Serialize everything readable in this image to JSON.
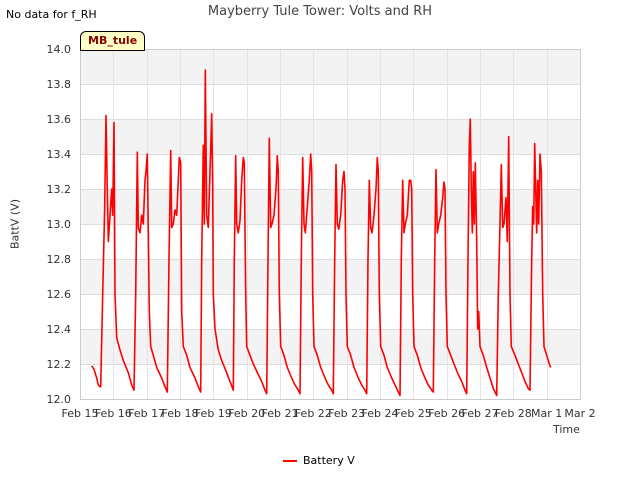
{
  "note": "No data for f_RH",
  "badge": "MB_tule",
  "chart_data": {
    "type": "line",
    "title": "Mayberry Tule Tower: Volts and RH",
    "xlabel": "Time",
    "ylabel": "BattV (V)",
    "ylim": [
      12.0,
      14.0
    ],
    "yticks": [
      12.0,
      12.2,
      12.4,
      12.6,
      12.8,
      13.0,
      13.2,
      13.4,
      13.6,
      13.8,
      14.0
    ],
    "ytick_labels": [
      "12.0",
      "12.2",
      "12.4",
      "12.6",
      "12.8",
      "13.0",
      "13.2",
      "13.4",
      "13.6",
      "13.8",
      "14.0"
    ],
    "xlim": [
      0,
      15
    ],
    "xticks": [
      0,
      1,
      2,
      3,
      4,
      5,
      6,
      7,
      8,
      9,
      10,
      11,
      12,
      13,
      14,
      15
    ],
    "xtick_labels": [
      "Feb 15",
      "Feb 16",
      "Feb 17",
      "Feb 18",
      "Feb 19",
      "Feb 20",
      "Feb 21",
      "Feb 22",
      "Feb 23",
      "Feb 24",
      "Feb 25",
      "Feb 26",
      "Feb 27",
      "Feb 28",
      "Mar 1",
      "Mar 2"
    ],
    "grid": true,
    "legend_position": "bottom",
    "series": [
      {
        "name": "Battery V",
        "color": "#ff0000",
        "points": [
          [
            0.35,
            12.19
          ],
          [
            0.42,
            12.17
          ],
          [
            0.5,
            12.12
          ],
          [
            0.55,
            12.08
          ],
          [
            0.6,
            12.07
          ],
          [
            0.62,
            12.07
          ],
          [
            0.68,
            12.6
          ],
          [
            0.74,
            13.1
          ],
          [
            0.78,
            13.62
          ],
          [
            0.82,
            13.2
          ],
          [
            0.85,
            12.9
          ],
          [
            0.9,
            13.05
          ],
          [
            0.95,
            13.2
          ],
          [
            0.98,
            13.05
          ],
          [
            1.02,
            13.58
          ],
          [
            1.05,
            12.6
          ],
          [
            1.1,
            12.35
          ],
          [
            1.2,
            12.28
          ],
          [
            1.3,
            12.22
          ],
          [
            1.45,
            12.15
          ],
          [
            1.55,
            12.08
          ],
          [
            1.62,
            12.05
          ],
          [
            1.67,
            12.6
          ],
          [
            1.72,
            13.41
          ],
          [
            1.75,
            12.98
          ],
          [
            1.8,
            12.95
          ],
          [
            1.85,
            13.05
          ],
          [
            1.9,
            13.0
          ],
          [
            1.95,
            13.25
          ],
          [
            1.98,
            13.3
          ],
          [
            2.02,
            13.4
          ],
          [
            2.08,
            12.5
          ],
          [
            2.12,
            12.3
          ],
          [
            2.2,
            12.25
          ],
          [
            2.3,
            12.18
          ],
          [
            2.45,
            12.12
          ],
          [
            2.55,
            12.07
          ],
          [
            2.62,
            12.04
          ],
          [
            2.67,
            12.8
          ],
          [
            2.72,
            13.42
          ],
          [
            2.75,
            12.98
          ],
          [
            2.8,
            13.0
          ],
          [
            2.85,
            13.08
          ],
          [
            2.9,
            13.05
          ],
          [
            2.95,
            13.25
          ],
          [
            2.98,
            13.38
          ],
          [
            3.02,
            13.35
          ],
          [
            3.05,
            12.5
          ],
          [
            3.1,
            12.3
          ],
          [
            3.2,
            12.25
          ],
          [
            3.3,
            12.18
          ],
          [
            3.45,
            12.12
          ],
          [
            3.55,
            12.07
          ],
          [
            3.62,
            12.04
          ],
          [
            3.65,
            12.8
          ],
          [
            3.7,
            13.45
          ],
          [
            3.73,
            13.0
          ],
          [
            3.76,
            13.88
          ],
          [
            3.8,
            13.05
          ],
          [
            3.85,
            12.98
          ],
          [
            3.9,
            13.3
          ],
          [
            3.95,
            13.63
          ],
          [
            3.98,
            13.2
          ],
          [
            4.0,
            12.6
          ],
          [
            4.05,
            12.4
          ],
          [
            4.15,
            12.28
          ],
          [
            4.25,
            12.22
          ],
          [
            4.4,
            12.15
          ],
          [
            4.5,
            12.1
          ],
          [
            4.6,
            12.05
          ],
          [
            4.63,
            12.8
          ],
          [
            4.67,
            13.39
          ],
          [
            4.7,
            13.0
          ],
          [
            4.75,
            12.95
          ],
          [
            4.8,
            13.02
          ],
          [
            4.85,
            13.25
          ],
          [
            4.9,
            13.38
          ],
          [
            4.93,
            13.35
          ],
          [
            4.97,
            12.6
          ],
          [
            5.0,
            12.3
          ],
          [
            5.1,
            12.25
          ],
          [
            5.2,
            12.2
          ],
          [
            5.35,
            12.14
          ],
          [
            5.45,
            12.1
          ],
          [
            5.55,
            12.05
          ],
          [
            5.6,
            12.03
          ],
          [
            5.64,
            12.8
          ],
          [
            5.68,
            13.49
          ],
          [
            5.72,
            12.98
          ],
          [
            5.76,
            13.0
          ],
          [
            5.82,
            13.05
          ],
          [
            5.88,
            13.2
          ],
          [
            5.92,
            13.39
          ],
          [
            5.95,
            13.3
          ],
          [
            5.98,
            12.6
          ],
          [
            6.02,
            12.3
          ],
          [
            6.12,
            12.25
          ],
          [
            6.22,
            12.18
          ],
          [
            6.35,
            12.12
          ],
          [
            6.45,
            12.08
          ],
          [
            6.55,
            12.05
          ],
          [
            6.6,
            12.03
          ],
          [
            6.64,
            12.8
          ],
          [
            6.68,
            13.38
          ],
          [
            6.72,
            13.0
          ],
          [
            6.76,
            12.95
          ],
          [
            6.82,
            13.1
          ],
          [
            6.88,
            13.25
          ],
          [
            6.92,
            13.4
          ],
          [
            6.95,
            13.3
          ],
          [
            6.98,
            12.6
          ],
          [
            7.02,
            12.3
          ],
          [
            7.12,
            12.25
          ],
          [
            7.22,
            12.18
          ],
          [
            7.35,
            12.12
          ],
          [
            7.45,
            12.08
          ],
          [
            7.55,
            12.05
          ],
          [
            7.6,
            12.03
          ],
          [
            7.64,
            12.8
          ],
          [
            7.68,
            13.34
          ],
          [
            7.72,
            13.0
          ],
          [
            7.76,
            12.97
          ],
          [
            7.82,
            13.05
          ],
          [
            7.88,
            13.25
          ],
          [
            7.92,
            13.3
          ],
          [
            7.95,
            13.2
          ],
          [
            7.98,
            12.6
          ],
          [
            8.02,
            12.3
          ],
          [
            8.12,
            12.25
          ],
          [
            8.22,
            12.18
          ],
          [
            8.35,
            12.12
          ],
          [
            8.45,
            12.08
          ],
          [
            8.55,
            12.05
          ],
          [
            8.6,
            12.03
          ],
          [
            8.64,
            12.8
          ],
          [
            8.68,
            13.25
          ],
          [
            8.72,
            12.98
          ],
          [
            8.76,
            12.95
          ],
          [
            8.82,
            13.05
          ],
          [
            8.88,
            13.2
          ],
          [
            8.92,
            13.38
          ],
          [
            8.95,
            13.3
          ],
          [
            8.98,
            12.6
          ],
          [
            9.02,
            12.3
          ],
          [
            9.12,
            12.25
          ],
          [
            9.22,
            12.18
          ],
          [
            9.35,
            12.12
          ],
          [
            9.45,
            12.08
          ],
          [
            9.55,
            12.04
          ],
          [
            9.6,
            12.02
          ],
          [
            9.64,
            12.8
          ],
          [
            9.68,
            13.25
          ],
          [
            9.72,
            12.95
          ],
          [
            9.76,
            13.0
          ],
          [
            9.82,
            13.05
          ],
          [
            9.88,
            13.25
          ],
          [
            9.92,
            13.25
          ],
          [
            9.95,
            13.2
          ],
          [
            9.98,
            12.6
          ],
          [
            10.02,
            12.3
          ],
          [
            10.12,
            12.25
          ],
          [
            10.22,
            12.18
          ],
          [
            10.35,
            12.12
          ],
          [
            10.45,
            12.08
          ],
          [
            10.55,
            12.05
          ],
          [
            10.6,
            12.04
          ],
          [
            10.64,
            12.8
          ],
          [
            10.68,
            13.31
          ],
          [
            10.72,
            12.95
          ],
          [
            10.76,
            13.0
          ],
          [
            10.82,
            13.05
          ],
          [
            10.88,
            13.15
          ],
          [
            10.92,
            13.24
          ],
          [
            10.95,
            13.2
          ],
          [
            10.98,
            12.6
          ],
          [
            11.02,
            12.3
          ],
          [
            11.12,
            12.25
          ],
          [
            11.22,
            12.2
          ],
          [
            11.35,
            12.14
          ],
          [
            11.45,
            12.1
          ],
          [
            11.55,
            12.05
          ],
          [
            11.6,
            12.03
          ],
          [
            11.64,
            12.8
          ],
          [
            11.68,
            13.45
          ],
          [
            11.71,
            13.6
          ],
          [
            11.74,
            13.2
          ],
          [
            11.77,
            12.95
          ],
          [
            11.8,
            13.3
          ],
          [
            11.83,
            13.0
          ],
          [
            11.86,
            13.35
          ],
          [
            11.9,
            12.9
          ],
          [
            11.93,
            12.4
          ],
          [
            11.96,
            12.5
          ],
          [
            12.0,
            12.3
          ],
          [
            12.1,
            12.25
          ],
          [
            12.2,
            12.18
          ],
          [
            12.3,
            12.12
          ],
          [
            12.4,
            12.06
          ],
          [
            12.5,
            12.02
          ],
          [
            12.55,
            12.6
          ],
          [
            12.6,
            13.0
          ],
          [
            12.64,
            13.34
          ],
          [
            12.68,
            12.98
          ],
          [
            12.72,
            13.0
          ],
          [
            12.78,
            13.15
          ],
          [
            12.82,
            12.9
          ],
          [
            12.86,
            13.5
          ],
          [
            12.9,
            12.6
          ],
          [
            12.94,
            12.3
          ],
          [
            13.05,
            12.25
          ],
          [
            13.15,
            12.2
          ],
          [
            13.25,
            12.15
          ],
          [
            13.35,
            12.1
          ],
          [
            13.45,
            12.06
          ],
          [
            13.5,
            12.05
          ],
          [
            13.55,
            12.8
          ],
          [
            13.58,
            13.1
          ],
          [
            13.61,
            13.0
          ],
          [
            13.64,
            13.46
          ],
          [
            13.67,
            13.2
          ],
          [
            13.7,
            12.95
          ],
          [
            13.73,
            13.25
          ],
          [
            13.76,
            13.0
          ],
          [
            13.8,
            13.4
          ],
          [
            13.84,
            13.3
          ],
          [
            13.88,
            12.6
          ],
          [
            13.92,
            12.3
          ],
          [
            14.0,
            12.25
          ],
          [
            14.08,
            12.2
          ],
          [
            14.12,
            12.18
          ]
        ]
      }
    ]
  }
}
